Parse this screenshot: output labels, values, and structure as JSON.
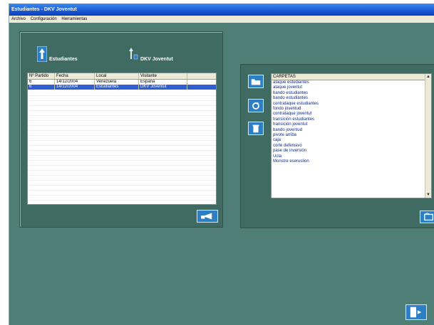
{
  "window": {
    "title": "Estudiantes - DKV Joventut"
  },
  "menu": [
    "Archivo",
    "Configuración",
    "Herramientas"
  ],
  "teams": {
    "home": "Estudiantes",
    "away": "DKV Joventut"
  },
  "matches": {
    "columns": [
      "Nº Partido",
      "Fecha",
      "Local",
      "Visitante"
    ],
    "rows": [
      [
        "6",
        "14/12/2004",
        "Venezuela",
        "España"
      ],
      [
        "6",
        "14/12/2004",
        "Estudiantes",
        "DKV Joventut"
      ]
    ],
    "selected_index": 1
  },
  "folders": {
    "header": "CARPETAS",
    "items": [
      "ataque estudiantes",
      "ataque joventut",
      "bando estudiantes",
      "bando estudiantes",
      "contrataque estudiantes",
      "fondo joventud",
      "contrataque joventut",
      "transición estudiantes",
      "transición joventut",
      "bando joventud",
      "pivote arriba",
      "caja",
      "corte defensivo",
      "pase de inversión",
      "Ucla",
      "Monstre eseruslion"
    ]
  },
  "colors": {
    "panel": "#3f6b63",
    "background": "#4f7e76",
    "button": "#2c7fc5",
    "selection": "#2f5fd0"
  }
}
